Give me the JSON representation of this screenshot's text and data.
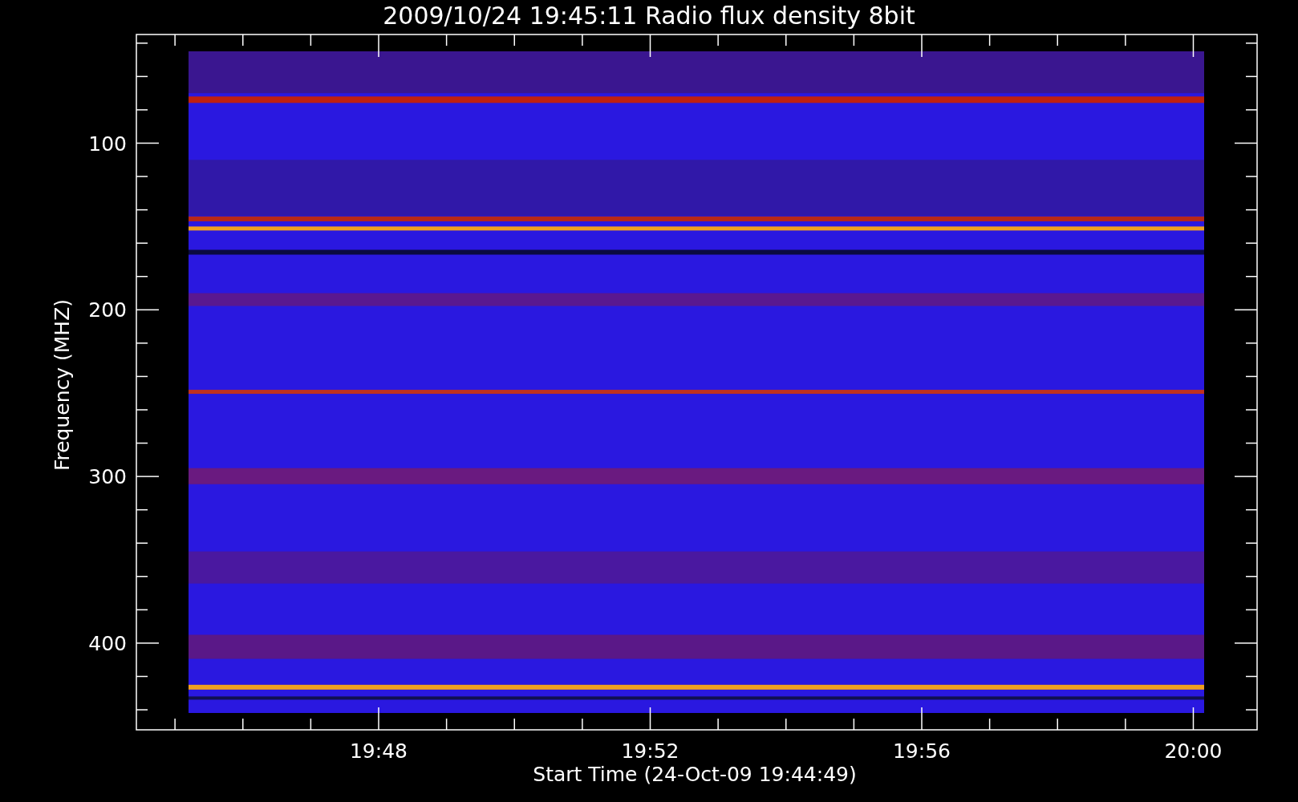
{
  "title": "2009/10/24 19:45:11 Radio flux density 8bit",
  "y_axis": {
    "label": "Frequency (MHZ)",
    "ticks": [
      "100",
      "200",
      "300",
      "400"
    ]
  },
  "x_axis": {
    "label": "Start Time (24-Oct-09 19:44:49)",
    "ticks": [
      "19:48",
      "19:52",
      "19:56",
      "20:00"
    ]
  }
}
